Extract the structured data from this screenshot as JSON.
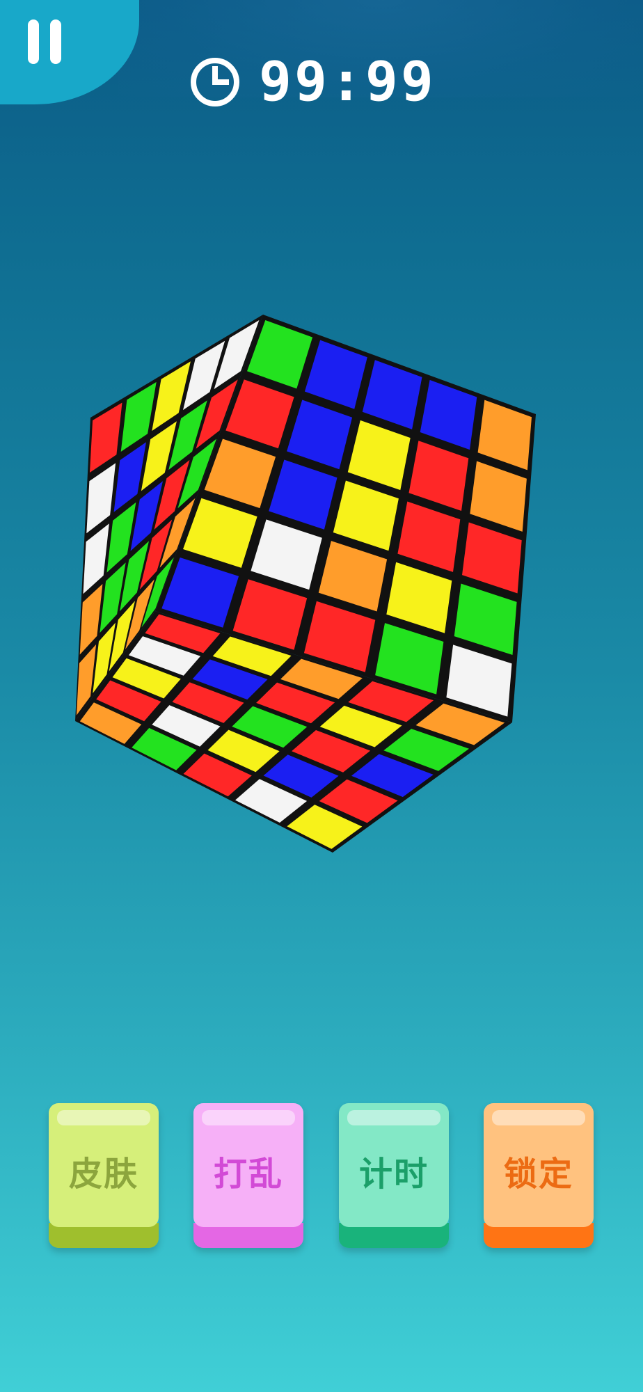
{
  "timer": {
    "value": "99:99",
    "icon": "clock-icon"
  },
  "pause": {
    "icon": "pause-icon"
  },
  "cube": {
    "front_face": [
      [
        "green",
        "blue",
        "blue",
        "blue",
        "orange"
      ],
      [
        "red",
        "blue",
        "yellow",
        "red",
        "orange"
      ],
      [
        "orange",
        "blue",
        "yellow",
        "red",
        "red"
      ],
      [
        "yellow",
        "white",
        "orange",
        "yellow",
        "green"
      ],
      [
        "blue",
        "red",
        "red",
        "green",
        "white"
      ]
    ],
    "left_face": [
      [
        "red",
        "green",
        "yellow",
        "white",
        "white"
      ],
      [
        "white",
        "blue",
        "yellow",
        "green",
        "red"
      ],
      [
        "white",
        "green",
        "blue",
        "red",
        "green"
      ],
      [
        "orange",
        "green",
        "green",
        "red",
        "orange"
      ],
      [
        "orange",
        "yellow",
        "yellow",
        "orange",
        "green"
      ]
    ]
  },
  "colors": {
    "green": "#23e21f",
    "blue": "#1b1ff2",
    "red": "#ff2727",
    "yellow": "#f7f21a",
    "orange": "#ff9d2b",
    "white": "#f4f4f4",
    "dark": "#111111"
  },
  "buttons": [
    {
      "label": "皮肤",
      "face": "#d6ef7a",
      "shade": "#9fbf2d",
      "text": "#8ca53d"
    },
    {
      "label": "打乱",
      "face": "#f6b0f7",
      "shade": "#e467e4",
      "text": "#d24ad6"
    },
    {
      "label": "计时",
      "face": "#83e8c6",
      "shade": "#19b37b",
      "text": "#1b9f69"
    },
    {
      "label": "锁定",
      "face": "#ffc27f",
      "shade": "#ff7414",
      "text": "#ec6b13"
    }
  ]
}
